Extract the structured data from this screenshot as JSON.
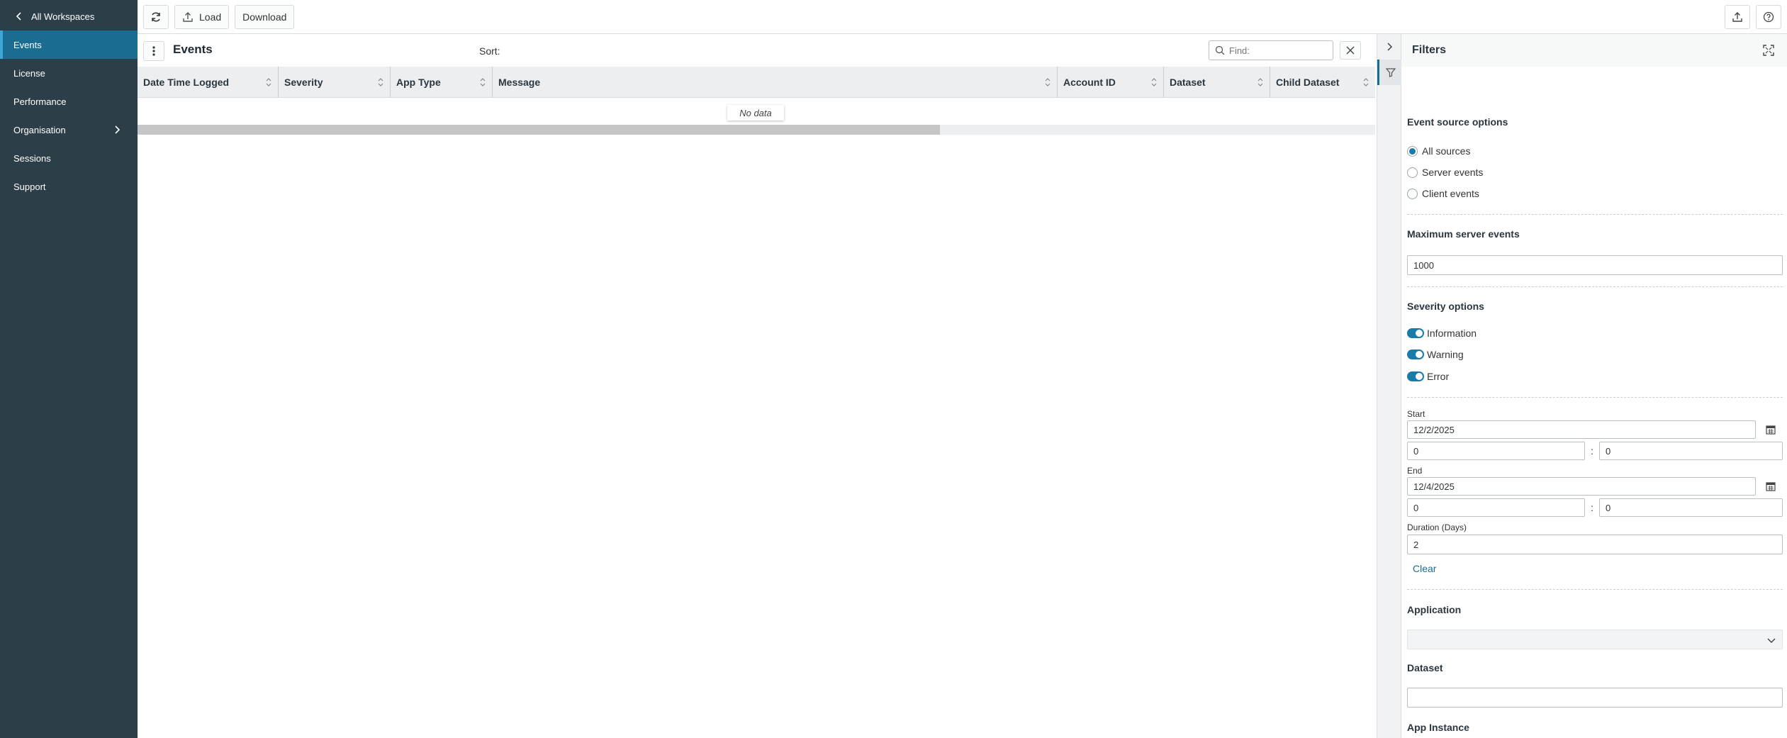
{
  "nav": {
    "back_label": "All Workspaces",
    "items": [
      {
        "label": "Events",
        "active": true
      },
      {
        "label": "License"
      },
      {
        "label": "Performance"
      },
      {
        "label": "Organisation",
        "has_children": true
      },
      {
        "label": "Sessions"
      },
      {
        "label": "Support"
      }
    ]
  },
  "toolbar": {
    "refresh_icon": "refresh-icon",
    "load_label": "Load",
    "download_label": "Download",
    "right_icons": [
      "export-icon",
      "help-icon"
    ]
  },
  "grid": {
    "title": "Events",
    "sort_label": "Sort:",
    "find_placeholder": "Find:",
    "find_value": "",
    "columns": [
      "Date Time Logged",
      "Severity",
      "App Type",
      "Message",
      "Account ID",
      "Dataset",
      "Child Dataset"
    ],
    "empty_text": "No data"
  },
  "filters": {
    "title": "Filters",
    "event_source": {
      "title": "Event source options",
      "options": [
        "All sources",
        "Server events",
        "Client events"
      ],
      "selected": "All sources"
    },
    "max_server_events": {
      "title": "Maximum server events",
      "value": "1000"
    },
    "severity": {
      "title": "Severity options",
      "options": [
        {
          "label": "Information",
          "on": true
        },
        {
          "label": "Warning",
          "on": true
        },
        {
          "label": "Error",
          "on": true
        }
      ]
    },
    "start": {
      "label": "Start",
      "date": "12/2/2025",
      "hour": "0",
      "minute": "0"
    },
    "end": {
      "label": "End",
      "date": "12/4/2025",
      "hour": "0",
      "minute": "0"
    },
    "duration": {
      "label": "Duration (Days)",
      "value": "2"
    },
    "time_separator": ":",
    "clear_label": "Clear",
    "application": {
      "title": "Application",
      "value": ""
    },
    "dataset": {
      "title": "Dataset",
      "value": ""
    },
    "app_instance": {
      "title": "App Instance",
      "value": ""
    }
  },
  "colors": {
    "nav_bg": "#2c3e47",
    "nav_active": "#1a6c90",
    "accent": "#1a7aa8"
  }
}
